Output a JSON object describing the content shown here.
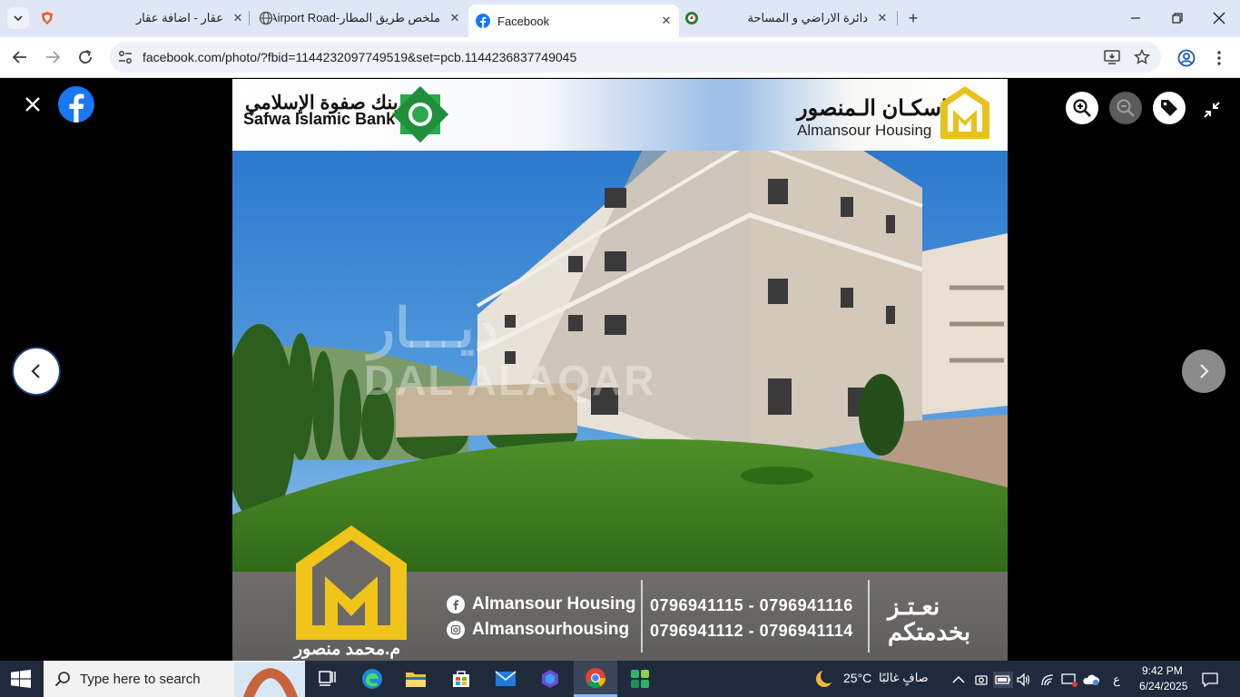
{
  "browser": {
    "tabs": [
      {
        "title": "عقار - اضافة عقار",
        "icon": "brave-shield-icon",
        "active": false
      },
      {
        "title": "ملخص طريق المطار-Airport Road",
        "icon": "globe-icon",
        "active": false
      },
      {
        "title": "Facebook",
        "icon": "facebook-icon",
        "active": true
      },
      {
        "title": "دائرة الاراضي و المساحة",
        "icon": "dls-icon",
        "active": false
      }
    ],
    "url": "facebook.com/photo/?fbid=1144232097749519&set=pcb.1144236837749045"
  },
  "photo": {
    "bank_name_ar": "بنك صفوة الإسلامي",
    "bank_name_en": "Safwa Islamic Bank",
    "company_name_ar": "إسكـان الـمنصور",
    "company_name_en": "Almansour Housing",
    "watermark_ar": "ديـــار",
    "watermark_en": "DAL ALAQAR",
    "facebook_handle": "Almansour Housing",
    "instagram_handle": "Almansourhousing",
    "phones_row1": "0796941115 - 0796941116",
    "phones_row2": "0796941112 - 0796941114",
    "slogan_line1": "نعـتـز",
    "slogan_line2": "بخدمتكم",
    "person": "م.محمد منصور"
  },
  "taskbar": {
    "search_placeholder": "Type here to search",
    "weather_temp": "25°C",
    "weather_condition": "صافٍ غالبًا",
    "lang": "ع",
    "time": "9:42 PM",
    "date": "6/24/2025"
  },
  "colors": {
    "facebook_blue": "#1877f2",
    "tabstrip": "#dfe6f5",
    "taskbar": "#202a3d",
    "gold": "#e8c21c"
  }
}
